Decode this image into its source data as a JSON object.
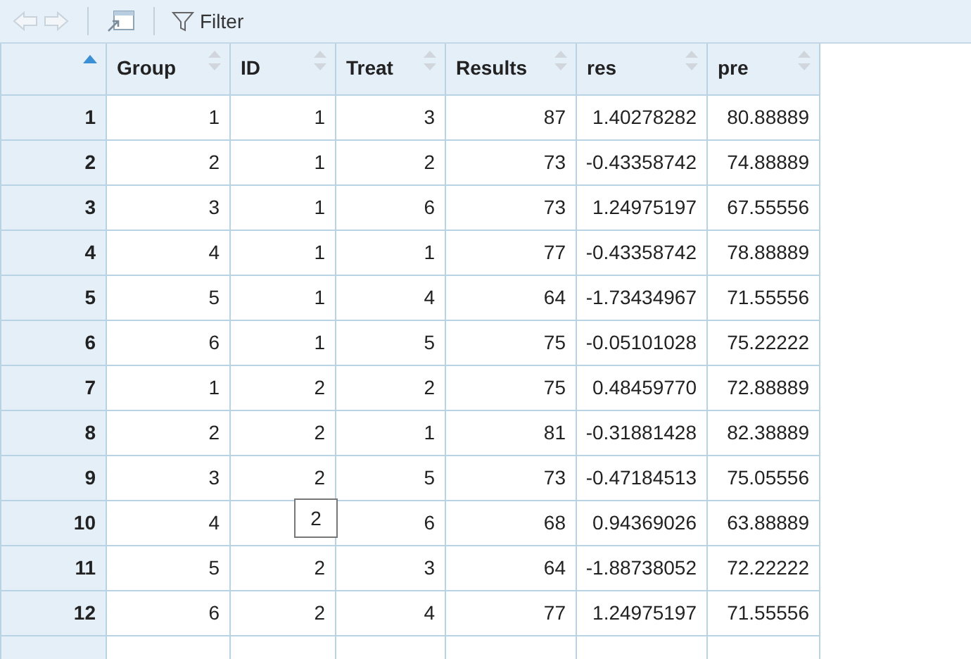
{
  "toolbar": {
    "back_disabled": true,
    "forward_disabled": true,
    "filter_label": "Filter"
  },
  "table": {
    "row_header_sorted": true,
    "columns": [
      {
        "label": "Group",
        "sorted": false
      },
      {
        "label": "ID",
        "sorted": false
      },
      {
        "label": "Treat",
        "sorted": false
      },
      {
        "label": "Results",
        "sorted": false
      },
      {
        "label": "res",
        "sorted": false
      },
      {
        "label": "pre",
        "sorted": false
      }
    ],
    "rows": [
      {
        "number": "1",
        "cells": [
          "1",
          "1",
          "3",
          "87",
          "1.40278282",
          "80.88889"
        ]
      },
      {
        "number": "2",
        "cells": [
          "2",
          "1",
          "2",
          "73",
          "-0.43358742",
          "74.88889"
        ]
      },
      {
        "number": "3",
        "cells": [
          "3",
          "1",
          "6",
          "73",
          "1.24975197",
          "67.55556"
        ]
      },
      {
        "number": "4",
        "cells": [
          "4",
          "1",
          "1",
          "77",
          "-0.43358742",
          "78.88889"
        ]
      },
      {
        "number": "5",
        "cells": [
          "5",
          "1",
          "4",
          "64",
          "-1.73434967",
          "71.55556"
        ]
      },
      {
        "number": "6",
        "cells": [
          "6",
          "1",
          "5",
          "75",
          "-0.05101028",
          "75.22222"
        ]
      },
      {
        "number": "7",
        "cells": [
          "1",
          "2",
          "2",
          "75",
          "0.48459770",
          "72.88889"
        ]
      },
      {
        "number": "8",
        "cells": [
          "2",
          "2",
          "1",
          "81",
          "-0.31881428",
          "82.38889"
        ]
      },
      {
        "number": "9",
        "cells": [
          "3",
          "2",
          "5",
          "73",
          "-0.47184513",
          "75.05556"
        ]
      },
      {
        "number": "10",
        "cells": [
          "4",
          null,
          "6",
          "68",
          "0.94369026",
          "63.88889"
        ],
        "tooltip": "2"
      },
      {
        "number": "11",
        "cells": [
          "5",
          "2",
          "3",
          "64",
          "-1.88738052",
          "72.22222"
        ]
      },
      {
        "number": "12",
        "cells": [
          "6",
          "2",
          "4",
          "77",
          "1.24975197",
          "71.55556"
        ]
      }
    ]
  }
}
